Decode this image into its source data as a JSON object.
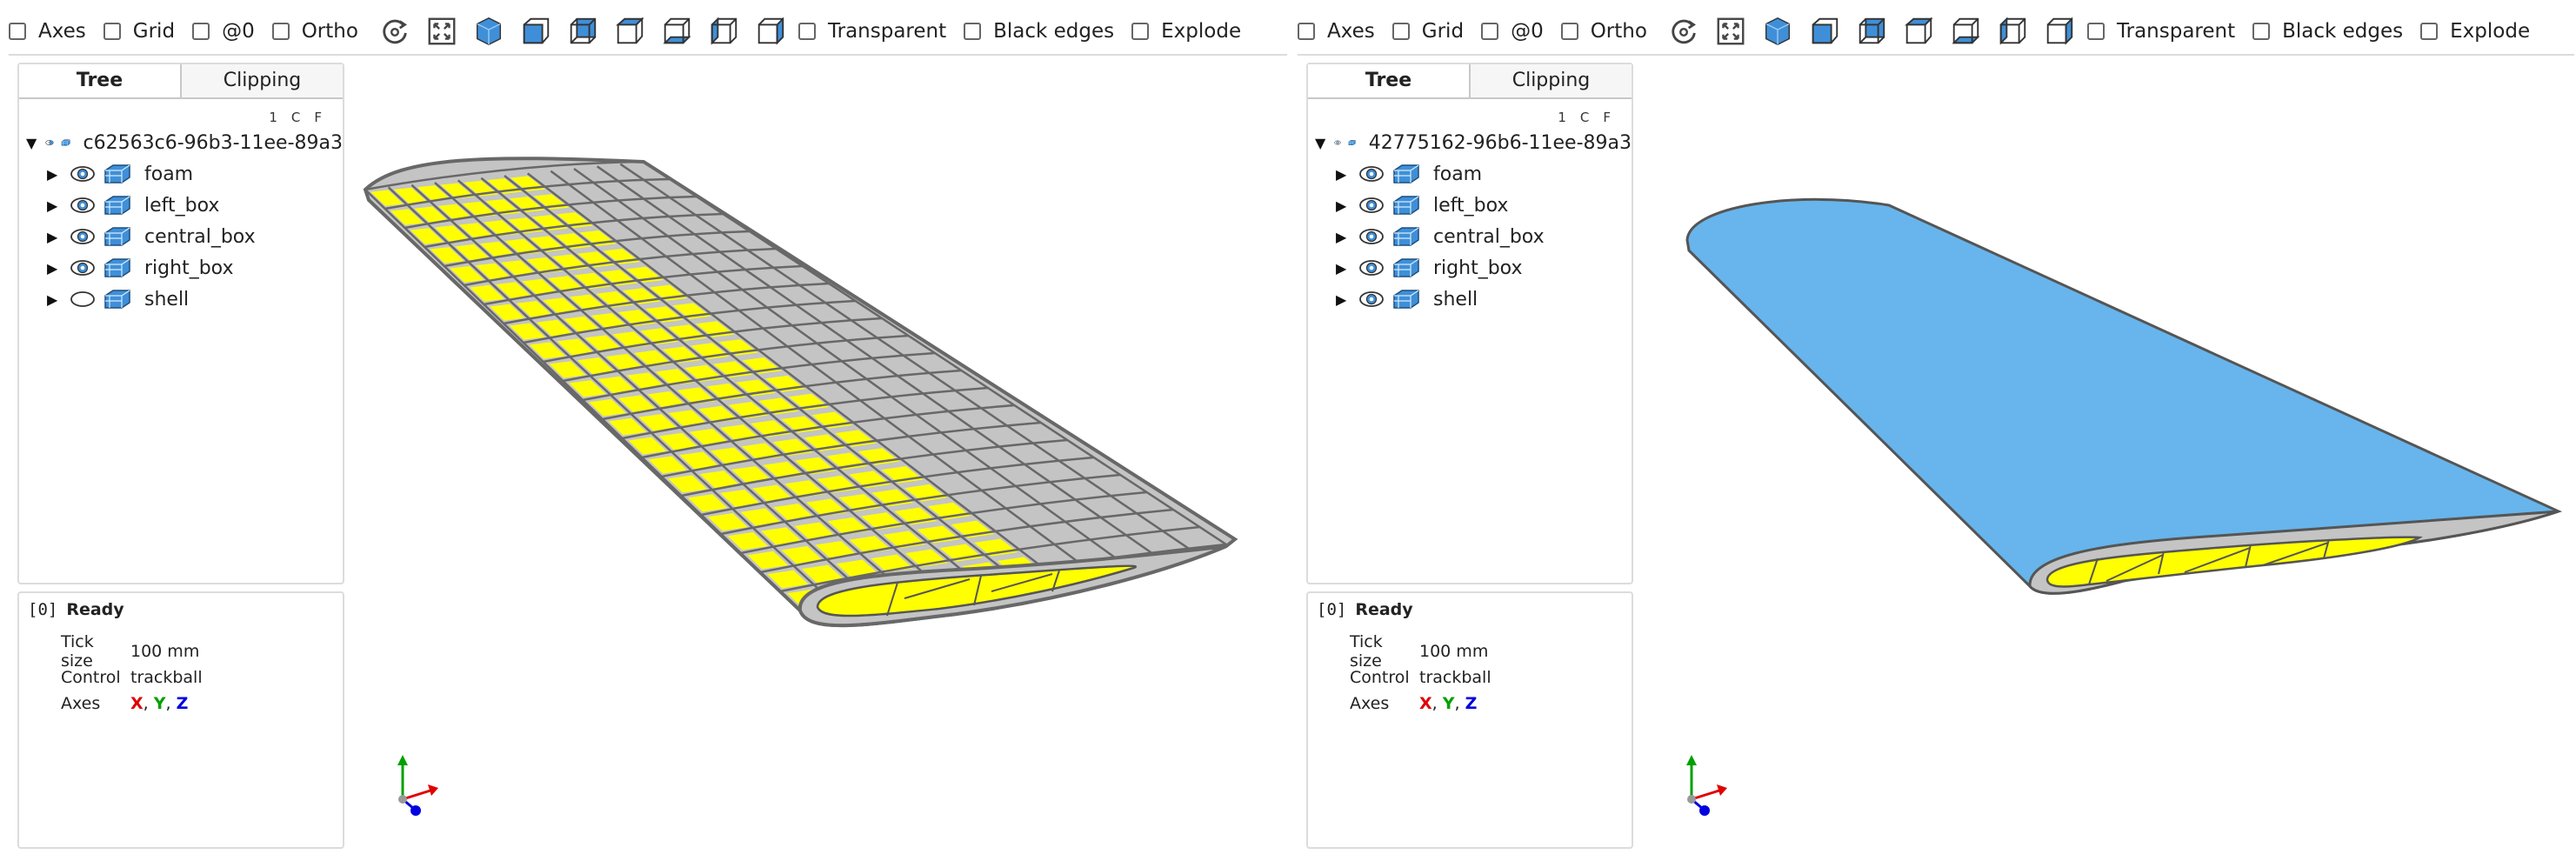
{
  "viewers": [
    {
      "toolbar": {
        "axes_label": "Axes",
        "grid_label": "Grid",
        "at0_label": "@0",
        "ortho_label": "Ortho",
        "transparent_label": "Transparent",
        "black_edges_label": "Black edges",
        "explode_label": "Explode"
      },
      "tabs": {
        "tree": "Tree",
        "clipping": "Clipping"
      },
      "col_heads": "1CF",
      "tree": {
        "root": "c62563c6-96b3-11ee-89a3",
        "items": [
          {
            "label": "foam",
            "visible": true
          },
          {
            "label": "left_box",
            "visible": true
          },
          {
            "label": "central_box",
            "visible": true
          },
          {
            "label": "right_box",
            "visible": true
          },
          {
            "label": "shell",
            "visible": false
          }
        ]
      },
      "info": {
        "code": "[0]",
        "status": "Ready",
        "tick_key": "Tick size",
        "tick_val": "100 mm",
        "control_key": "Control",
        "control_val": "trackball",
        "axes_key": "Axes",
        "ax_x": "X",
        "ax_y": "Y",
        "ax_z": "Z",
        "sep": ","
      }
    },
    {
      "toolbar": {
        "axes_label": "Axes",
        "grid_label": "Grid",
        "at0_label": "@0",
        "ortho_label": "Ortho",
        "transparent_label": "Transparent",
        "black_edges_label": "Black edges",
        "explode_label": "Explode"
      },
      "tabs": {
        "tree": "Tree",
        "clipping": "Clipping"
      },
      "col_heads": "1CF",
      "tree": {
        "root": "42775162-96b6-11ee-89a3",
        "items": [
          {
            "label": "foam",
            "visible": true
          },
          {
            "label": "left_box",
            "visible": true
          },
          {
            "label": "central_box",
            "visible": true
          },
          {
            "label": "right_box",
            "visible": true
          },
          {
            "label": "shell",
            "visible": true
          }
        ]
      },
      "info": {
        "code": "[0]",
        "status": "Ready",
        "tick_key": "Tick size",
        "tick_val": "100 mm",
        "control_key": "Control",
        "control_val": "trackball",
        "axes_key": "Axes",
        "ax_x": "X",
        "ax_y": "Y",
        "ax_z": "Z",
        "sep": ","
      }
    }
  ],
  "colors": {
    "accent_blue": "#3f8fd8",
    "shell_blue": "#67b5ec",
    "foam_yellow": "#ffff00",
    "structure_gray": "#c4c4c4",
    "axis_x": "#e00000",
    "axis_y": "#00a000",
    "axis_z": "#0000e0"
  }
}
